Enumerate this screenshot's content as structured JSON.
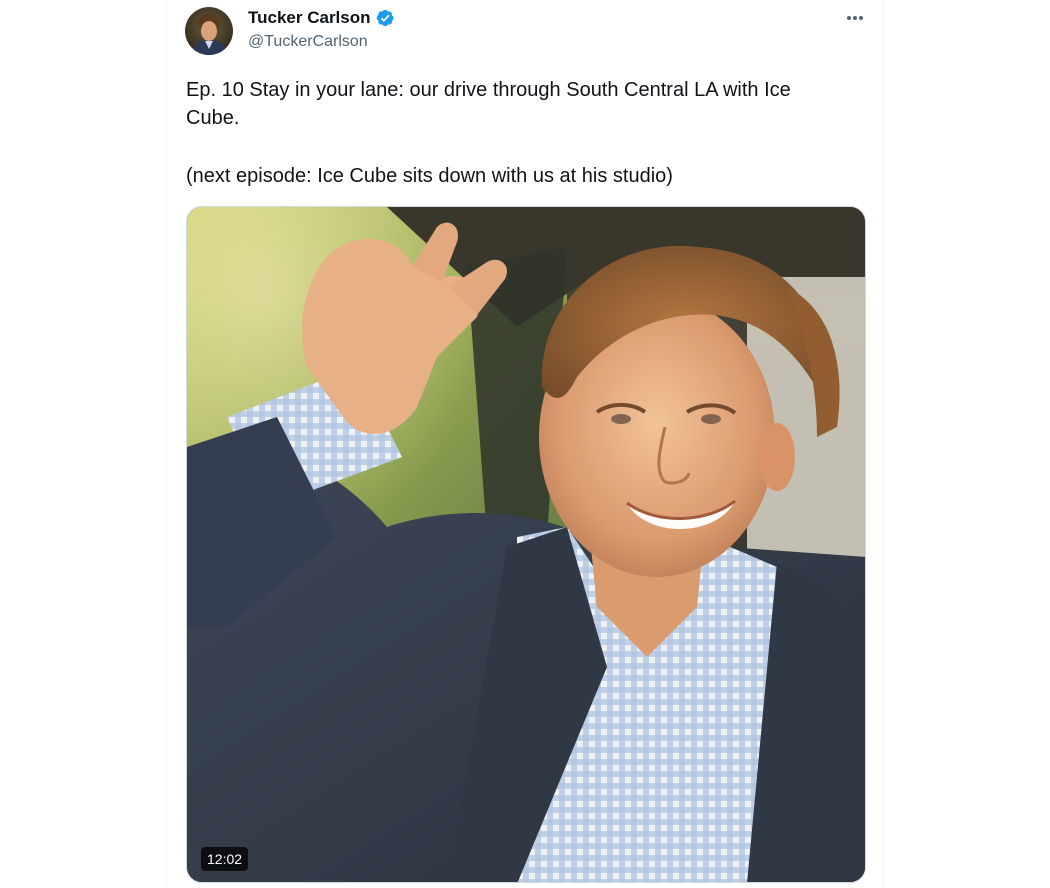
{
  "tweet": {
    "author": {
      "display_name": "Tucker Carlson",
      "handle": "@TuckerCarlson",
      "verified_icon": "verified-badge-icon"
    },
    "more_icon": "more-options-icon",
    "text": {
      "line1": "Ep. 10  Stay in your lane: our drive through South Central LA with Ice Cube.",
      "line2": "(next episode: Ice Cube sits down with us at his studio)"
    },
    "media": {
      "type": "video",
      "duration": "12:02"
    }
  },
  "colors": {
    "primary_text": "#0f1419",
    "secondary_text": "#536471",
    "verified_blue": "#1d9bf0",
    "border": "#eff3f4"
  }
}
